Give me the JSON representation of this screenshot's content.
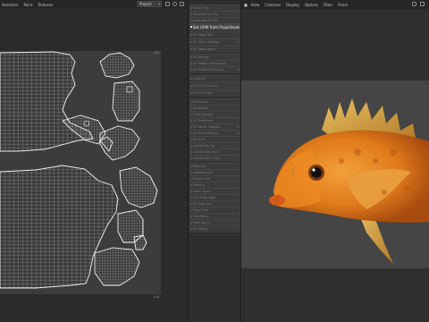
{
  "uv_menu": {
    "items": [
      "Selection",
      "Paint",
      "Textures"
    ],
    "dropdown_value": "Project"
  },
  "uv_canvas": {
    "top_right_label": "1,1",
    "bottom_right_label": "1,0"
  },
  "tool_panel": {
    "items": [
      {
        "label": "Collect Tex",
        "active": false
      },
      {
        "label": "Generate UV Tex",
        "active": false
      },
      {
        "label": "Generate UV Tex",
        "active": false
      },
      {
        "label": "Set UVW from Projection",
        "active": true
      },
      {
        "label": "UV Relax Tool",
        "active": false
      },
      {
        "label": "UV Relax Settings",
        "active": false
      },
      {
        "label": "UV Relax Apply",
        "active": false
      },
      {
        "label": "UV Terrace",
        "active": false
      },
      {
        "label": "UV Pattern Reshaping",
        "active": false
      },
      {
        "label": "UV Pattern Transform",
        "active": false
      },
      {
        "label": "Scale UV",
        "active": false
      },
      {
        "label": "Fit UV to Canvas",
        "active": false
      },
      {
        "label": "Fit UV to Tile",
        "active": false
      },
      {
        "label": "Normalize",
        "active": false
      },
      {
        "label": "Straighten",
        "active": false
      },
      {
        "label": "Unify Density",
        "active": false
      },
      {
        "label": "UV Transform",
        "active": false
      },
      {
        "label": "UV Mirror Settings",
        "active": false
      },
      {
        "label": "UV Snap Settings",
        "active": false
      },
      {
        "label": "UV Grid",
        "active": false
      },
      {
        "label": "Island Settings",
        "active": false
      },
      {
        "label": "Islands Selection",
        "active": false
      },
      {
        "label": "Island Select Tools",
        "active": false
      },
      {
        "label": "Relaxing",
        "active": false
      },
      {
        "label": "Optimal Cuts",
        "active": false
      },
      {
        "label": "Seams Tool",
        "active": false
      },
      {
        "label": "Packing",
        "active": false
      },
      {
        "label": "Seam Sharp",
        "active": false
      },
      {
        "label": "Cut Seam Edge",
        "active": false
      },
      {
        "label": "UV Edge Tool",
        "active": false
      },
      {
        "label": "Seam Tool",
        "active": false
      },
      {
        "label": "Grid Relax",
        "active": false
      },
      {
        "label": "Mark Seam",
        "active": false
      },
      {
        "label": "Pin Vertex",
        "active": false
      }
    ]
  },
  "viewport_menu": {
    "items": [
      "View",
      "Cameras",
      "Display",
      "Options",
      "Filter",
      "Panel"
    ]
  },
  "colors": {
    "accent_active": "#f0f0f0",
    "uv_wire": "#e8e8e8",
    "uv_canvas_bg": "#3c3c3c",
    "fish_body": "#e07a1a"
  }
}
